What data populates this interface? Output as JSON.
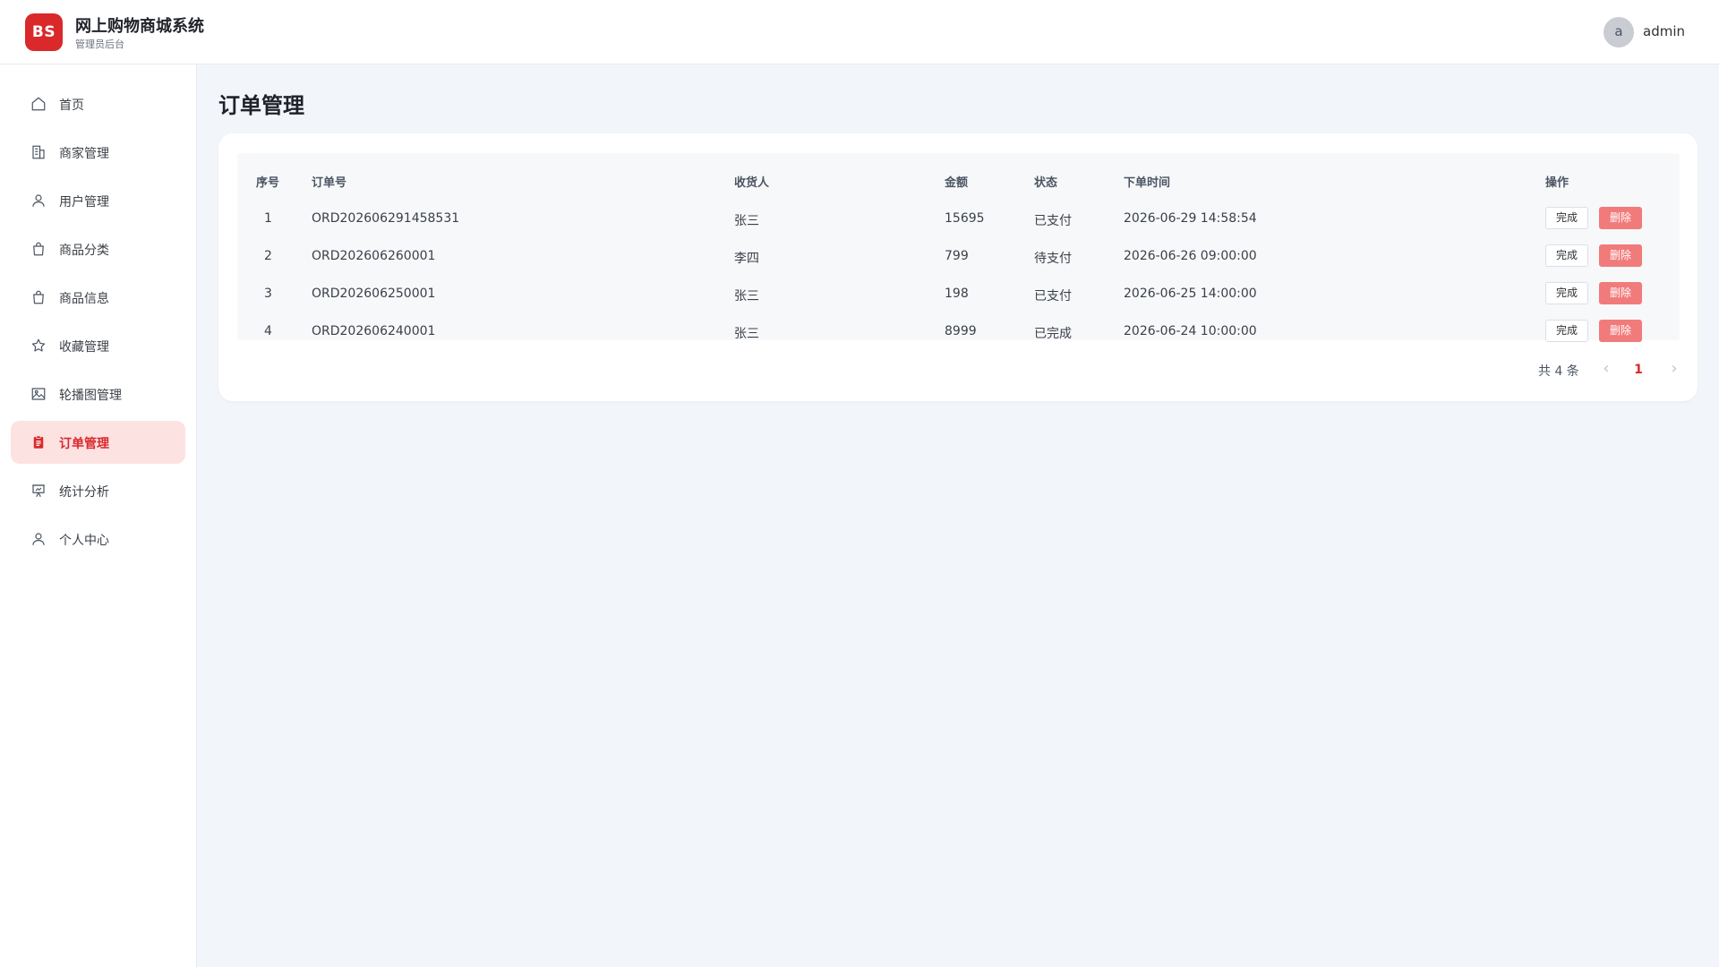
{
  "header": {
    "logo": "BS",
    "title": "网上购物商城系统",
    "subtitle": "管理员后台",
    "avatar_letter": "a",
    "username": "admin"
  },
  "sidebar": {
    "items": [
      {
        "label": "首页",
        "icon": "home-icon"
      },
      {
        "label": "商家管理",
        "icon": "building-icon"
      },
      {
        "label": "用户管理",
        "icon": "user-icon"
      },
      {
        "label": "商品分类",
        "icon": "shopping-bag-icon"
      },
      {
        "label": "商品信息",
        "icon": "shopping-bag-icon"
      },
      {
        "label": "收藏管理",
        "icon": "star-icon"
      },
      {
        "label": "轮播图管理",
        "icon": "image-icon"
      },
      {
        "label": "订单管理",
        "icon": "clipboard-icon",
        "active": true
      },
      {
        "label": "统计分析",
        "icon": "presentation-chart-icon"
      },
      {
        "label": "个人中心",
        "icon": "user-icon"
      }
    ]
  },
  "main": {
    "title": "订单管理",
    "table": {
      "headers": [
        "序号",
        "订单号",
        "收货人",
        "金额",
        "状态",
        "下单时间",
        "操作"
      ],
      "rows": [
        [
          "1",
          "ORD202606291458531",
          "张三",
          "15695",
          "已支付",
          "2026-06-29 14:58:54"
        ],
        [
          "2",
          "ORD202606260001",
          "李四",
          "799",
          "待支付",
          "2026-06-26 09:00:00"
        ],
        [
          "3",
          "ORD202606250001",
          "张三",
          "198",
          "已支付",
          "2026-06-25 14:00:00"
        ],
        [
          "4",
          "ORD202606240001",
          "张三",
          "8999",
          "已完成",
          "2026-06-24 10:00:00"
        ]
      ],
      "action_done": "完成",
      "action_delete": "删除"
    },
    "pagination": {
      "total": "共 4 条",
      "current_page": "1",
      "prev": "‹",
      "next": "›"
    }
  },
  "colors": {
    "accent": "#d9292b",
    "delete_button": "#f17b7b",
    "active_nav_bg": "#fde2e2",
    "page_bg": "#f2f5f9"
  }
}
